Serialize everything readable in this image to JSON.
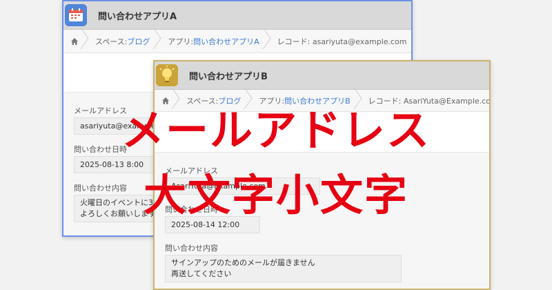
{
  "window_a": {
    "title": "問い合わせアプリA",
    "breadcrumb": {
      "space_prefix": "スペース: ",
      "space_link": "ブログ",
      "app_prefix": "アプリ: ",
      "app_link": "問い合わせアプリA",
      "record": "レコード: asariyuta@example.com"
    },
    "fields": {
      "email_label": "メールアドレス",
      "email_value": "asariyuta@example.com",
      "datetime_label": "問い合わせ日時",
      "datetime_value": "2025-08-13 8:00",
      "content_label": "問い合わせ内容",
      "content_line1": "火曜日のイベントに3名",
      "content_line2": "よろしくお願いします"
    }
  },
  "window_b": {
    "title": "問い合わせアプリB",
    "breadcrumb": {
      "space_prefix": "スペース: ",
      "space_link": "ブログ",
      "app_prefix": "アプリ: ",
      "app_link": "問い合わせアプリB",
      "record": "レコード: AsariYuta@Example.com"
    },
    "fields": {
      "email_label": "メールアドレス",
      "email_value": "AsariYuta@Example.com",
      "datetime_label": "問い合わせ日時",
      "datetime_value": "2025-08-14 12:00",
      "content_label": "問い合わせ内容",
      "content_line1": "サインアップのためのメールが届きません",
      "content_line2": "再送してください"
    }
  },
  "overlay": {
    "line1": "メールアドレス",
    "line2": "大文字小文字"
  },
  "icons": {
    "app_a": "calendar-icon",
    "app_b": "lightbulb-icon",
    "home": "home-icon"
  },
  "colors": {
    "overlay_red": "#e60012",
    "link_blue": "#3b7bd6",
    "window_a_border": "#6d8fe8",
    "window_b_border": "#c9b36a"
  }
}
